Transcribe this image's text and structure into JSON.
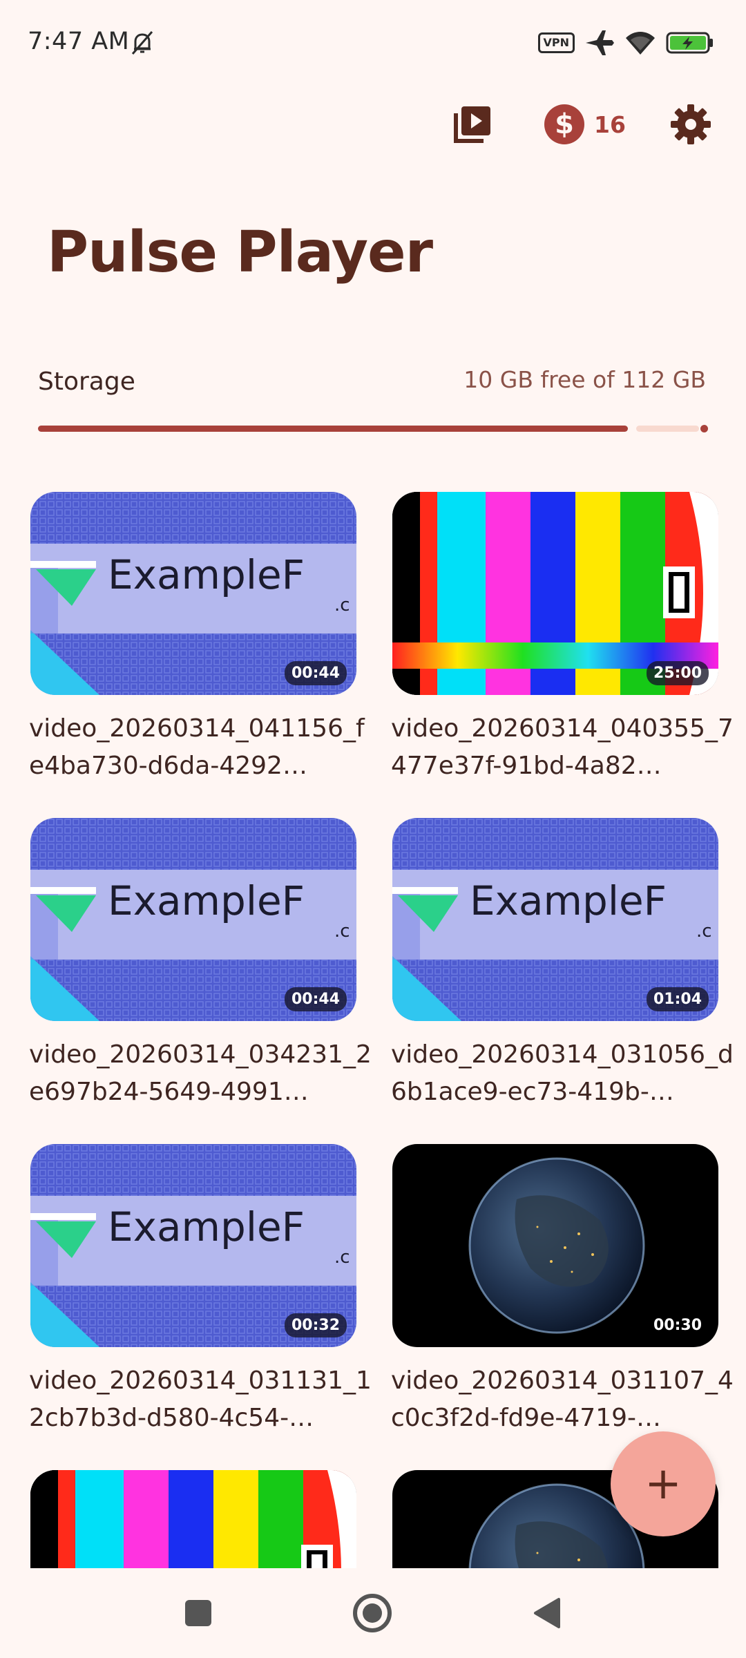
{
  "status_bar": {
    "time": "7:47 AM",
    "vpn_label": "VPN",
    "icons": [
      "dnd-off-icon",
      "vpn-icon",
      "airplane-icon",
      "wifi-icon",
      "battery-charging-icon"
    ]
  },
  "top_actions": {
    "playlist_icon": "video-library-icon",
    "coin_symbol": "$",
    "coin_count": "16",
    "settings_icon": "gear-icon"
  },
  "app": {
    "title": "Pulse Player"
  },
  "storage": {
    "label": "Storage",
    "free_text": "10 GB free of 112 GB",
    "used_fraction": 0.91
  },
  "videos": [
    {
      "title": "video_20260314_041156_fe4ba730-d6da-4292…",
      "duration": "00:44",
      "thumb": "example-logo"
    },
    {
      "title": "video_20260314_040355_7477e37f-91bd-4a82…",
      "duration": "25:00",
      "thumb": "color-bars"
    },
    {
      "title": "video_20260314_034231_2e697b24-5649-4991…",
      "duration": "00:44",
      "thumb": "example-logo"
    },
    {
      "title": "video_20260314_031056_d6b1ace9-ec73-419b-…",
      "duration": "01:04",
      "thumb": "example-logo"
    },
    {
      "title": "video_20260314_031131_12cb7b3d-d580-4c54-…",
      "duration": "00:32",
      "thumb": "example-logo"
    },
    {
      "title": "video_20260314_031107_4c0c3f2d-fd9e-4719-…",
      "duration": "00:30",
      "thumb": "earth"
    },
    {
      "title": "",
      "duration": "",
      "thumb": "color-bars"
    },
    {
      "title": "",
      "duration": "",
      "thumb": "earth"
    }
  ],
  "thumb_text": {
    "logo_word": "ExampleF",
    "logo_sub": ".c"
  },
  "fab": {
    "label": "+"
  },
  "nav": {
    "icons": [
      "recents-square-icon",
      "home-circle-icon",
      "back-triangle-icon"
    ]
  },
  "colors": {
    "accent": "#A8413A",
    "background": "#FFF6F3",
    "fab": "#F4A59A",
    "title": "#5A2A1E"
  }
}
